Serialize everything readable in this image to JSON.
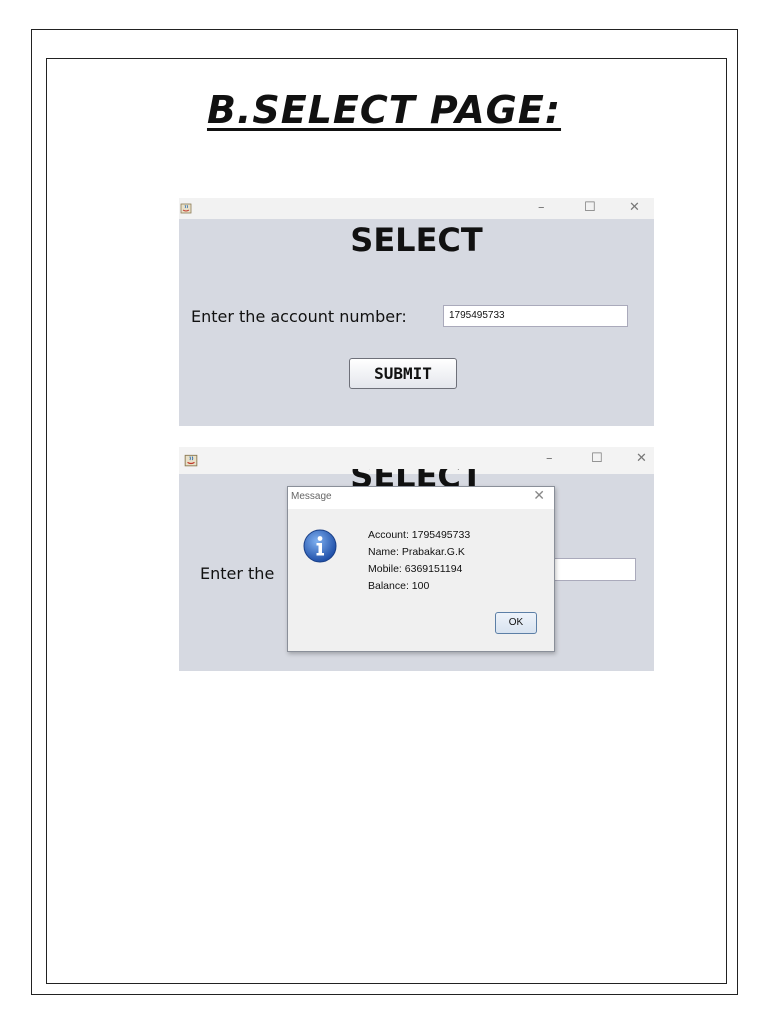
{
  "page": {
    "heading": "B.SELECT PAGE:"
  },
  "window1": {
    "title": "SELECT",
    "controls": {
      "minimize": "–",
      "maximize": "☐",
      "close": "✕"
    },
    "label": "Enter the account number:",
    "input_value": "1795495733",
    "submit_label": "SUBMIT"
  },
  "window2": {
    "title": "SELECT",
    "controls": {
      "minimize": "–",
      "maximize": "☐",
      "close": "✕"
    },
    "label_partial": "Enter the"
  },
  "dialog": {
    "title": "Message",
    "close": "✕",
    "lines": [
      "Account: 1795495733",
      "Name: Prabakar.G.K",
      "Mobile: 6369151194",
      "Balance: 100"
    ],
    "ok_label": "OK",
    "icon": "info-icon"
  },
  "colors": {
    "window_bg": "#d6d9e1",
    "info_blue": "#2b63c6"
  }
}
